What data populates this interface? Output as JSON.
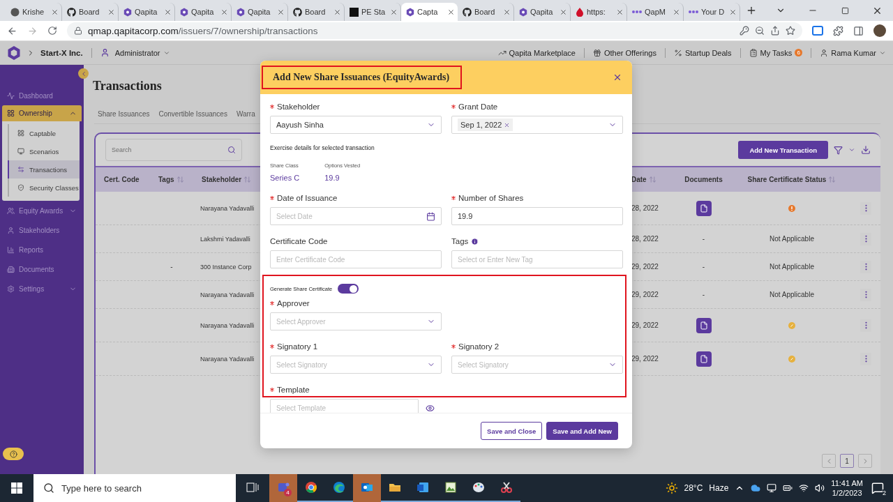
{
  "browser": {
    "tabs": [
      {
        "kind": "round",
        "title": "Krishe",
        "selected": false
      },
      {
        "kind": "github",
        "title": "Board",
        "selected": false
      },
      {
        "kind": "hexagon",
        "title": "Qapita",
        "selected": false
      },
      {
        "kind": "hexagon",
        "title": "Qapita",
        "selected": false
      },
      {
        "kind": "hexagon",
        "title": "Qapita",
        "selected": false
      },
      {
        "kind": "github",
        "title": "Board",
        "selected": false
      },
      {
        "kind": "square",
        "title": "PE Sta",
        "selected": false
      },
      {
        "kind": "hexagon",
        "title": "Capta",
        "selected": true
      },
      {
        "kind": "github",
        "title": "Board",
        "selected": false
      },
      {
        "kind": "hexagon",
        "title": "Qapita",
        "selected": false
      },
      {
        "kind": "drop",
        "title": "https:",
        "selected": false
      },
      {
        "kind": "dots",
        "title": "QapM",
        "selected": false
      },
      {
        "kind": "dots",
        "title": "Your D",
        "selected": false
      }
    ],
    "url_host": "qmap.qapitacorp.com",
    "url_path": "/issuers/7/ownership/transactions"
  },
  "header": {
    "company": "Start-X Inc.",
    "role": "Administrator",
    "links": [
      {
        "kind": "chart",
        "label": "Qapita Marketplace"
      },
      {
        "kind": "gift",
        "label": "Other Offerings"
      },
      {
        "kind": "percent",
        "label": "Startup Deals"
      },
      {
        "kind": "tasks",
        "label": "My Tasks",
        "badge": "6"
      }
    ],
    "user": "Rama Kumar"
  },
  "sidebar": {
    "items": [
      {
        "kind": "dashboard",
        "label": "Dashboard"
      },
      {
        "kind": "ownership",
        "label": "Ownership",
        "expanded": true,
        "children": [
          {
            "kind": "captable",
            "label": "Captable",
            "selected": false
          },
          {
            "kind": "scenarios",
            "label": "Scenarios",
            "selected": false
          },
          {
            "kind": "transactions",
            "label": "Transactions",
            "selected": true
          },
          {
            "kind": "security",
            "label": "Security Classes",
            "selected": false
          }
        ]
      },
      {
        "kind": "equity",
        "label": "Equity Awards",
        "expanded": false
      },
      {
        "kind": "stakeholders",
        "label": "Stakeholders"
      },
      {
        "kind": "reports",
        "label": "Reports"
      },
      {
        "kind": "documents",
        "label": "Documents"
      },
      {
        "kind": "settings",
        "label": "Settings",
        "expanded": false
      }
    ]
  },
  "page": {
    "title": "Transactions",
    "tabs": [
      {
        "label": "Share Issuances"
      },
      {
        "label": "Convertible Issuances"
      },
      {
        "label": "Warra"
      }
    ]
  },
  "table": {
    "search_placeholder": "Search",
    "add_button": "Add New Transaction",
    "columns": [
      {
        "label": "Cert. Code",
        "sortable": false
      },
      {
        "label": "Tags",
        "sortable": true
      },
      {
        "label": "Stakeholder",
        "sortable": true
      },
      {
        "label": "Date",
        "sortable": true
      },
      {
        "label": "Documents",
        "sortable": false
      },
      {
        "label": "Share Certificate Status",
        "sortable": true
      }
    ],
    "rows": [
      {
        "stakeholder": "Narayana Yadavalli",
        "date": "28, 2022",
        "document": {
          "kind": "file"
        },
        "status": {
          "kind": "alert",
          "color": "#e6782c"
        }
      },
      {
        "stakeholder": "Lakshmi Yadavalli",
        "date": "28, 2022",
        "document": {
          "kind": "text",
          "text": "-"
        },
        "status": {
          "kind": "text",
          "text": "Not Applicable"
        }
      },
      {
        "tags": "-",
        "stakeholder": "300 Instance Corp",
        "date": "29, 2022",
        "document": {
          "kind": "text",
          "text": "-"
        },
        "status": {
          "kind": "text",
          "text": "Not Applicable"
        }
      },
      {
        "stakeholder": "Narayana Yadavalli",
        "date": "29, 2022",
        "document": {
          "kind": "text",
          "text": "-"
        },
        "status": {
          "kind": "text",
          "text": "Not Applicable"
        }
      },
      {
        "stakeholder": "Narayana Yadavalli",
        "date": "29, 2022",
        "document": {
          "kind": "file"
        },
        "status": {
          "kind": "pending",
          "color": "#e6b13e"
        }
      },
      {
        "stakeholder": "Narayana Yadavalli",
        "date": "29, 2022",
        "document": {
          "kind": "file"
        },
        "status": {
          "kind": "pending",
          "color": "#e6b13e"
        }
      }
    ],
    "pages": [
      {
        "label": "1",
        "selected": true
      }
    ]
  },
  "modal": {
    "title": "Add New Share Issuances (EquityAwards)",
    "title_highlighted": true,
    "top_fields": [
      {
        "kind": "select",
        "label": "Stakeholder",
        "required": true,
        "value": "Aayush Sinha"
      },
      {
        "kind": "chip",
        "label": "Grant Date",
        "required": true,
        "value": "Sep 1, 2022"
      }
    ],
    "exercise": {
      "heading": "Exercise details for selected transaction",
      "items": [
        {
          "label": "Share Class",
          "value": "Series C"
        },
        {
          "label": "Options Vested",
          "value": "19.9"
        }
      ]
    },
    "fields": [
      {
        "kind": "date",
        "label": "Date of Issuance",
        "required": true,
        "placeholder": "Select Date"
      },
      {
        "kind": "input",
        "label": "Number of Shares",
        "required": true,
        "value": "19.9"
      },
      {
        "kind": "input",
        "label": "Certificate Code",
        "required": false,
        "placeholder": "Enter Certificate Code"
      },
      {
        "kind": "input",
        "label": "Tags",
        "required": false,
        "info": true,
        "placeholder": "Select or Enter New Tag"
      }
    ],
    "certificate": {
      "highlighted": true,
      "toggle_label": "Generate Share Certificate",
      "on": true,
      "approver": {
        "kind": "select",
        "label": "Approver",
        "required": true,
        "placeholder": "Select Approver"
      },
      "signatories": [
        {
          "kind": "select",
          "label": "Signatory 1",
          "required": true,
          "placeholder": "Select Signatory"
        },
        {
          "kind": "select",
          "label": "Signatory 2",
          "required": true,
          "placeholder": "Select Signatory"
        }
      ],
      "template": {
        "label": "Template",
        "required": true,
        "placeholder": "Select Template"
      }
    },
    "buttons": [
      {
        "kind": "secondary",
        "label": "Save and Close"
      },
      {
        "kind": "primary",
        "label": "Save and Add New"
      }
    ]
  },
  "taskbar": {
    "search_placeholder": "Type here to search",
    "apps": [
      {
        "kind": "teams",
        "badge": "4",
        "flashing": true
      },
      {
        "kind": "chrome",
        "flashing": false
      },
      {
        "kind": "edge",
        "flashing": false
      },
      {
        "kind": "outlook",
        "flashing": true
      },
      {
        "kind": "explorer",
        "flashing": false
      },
      {
        "kind": "word",
        "flashing": false
      },
      {
        "kind": "sheet",
        "flashing": false
      },
      {
        "kind": "paint",
        "flashing": false
      },
      {
        "kind": "snip",
        "flashing": false
      }
    ],
    "temperature": "28°C",
    "condition": "Haze",
    "time": "11:41 AM",
    "date": "1/2/2023",
    "notifications": "2"
  }
}
